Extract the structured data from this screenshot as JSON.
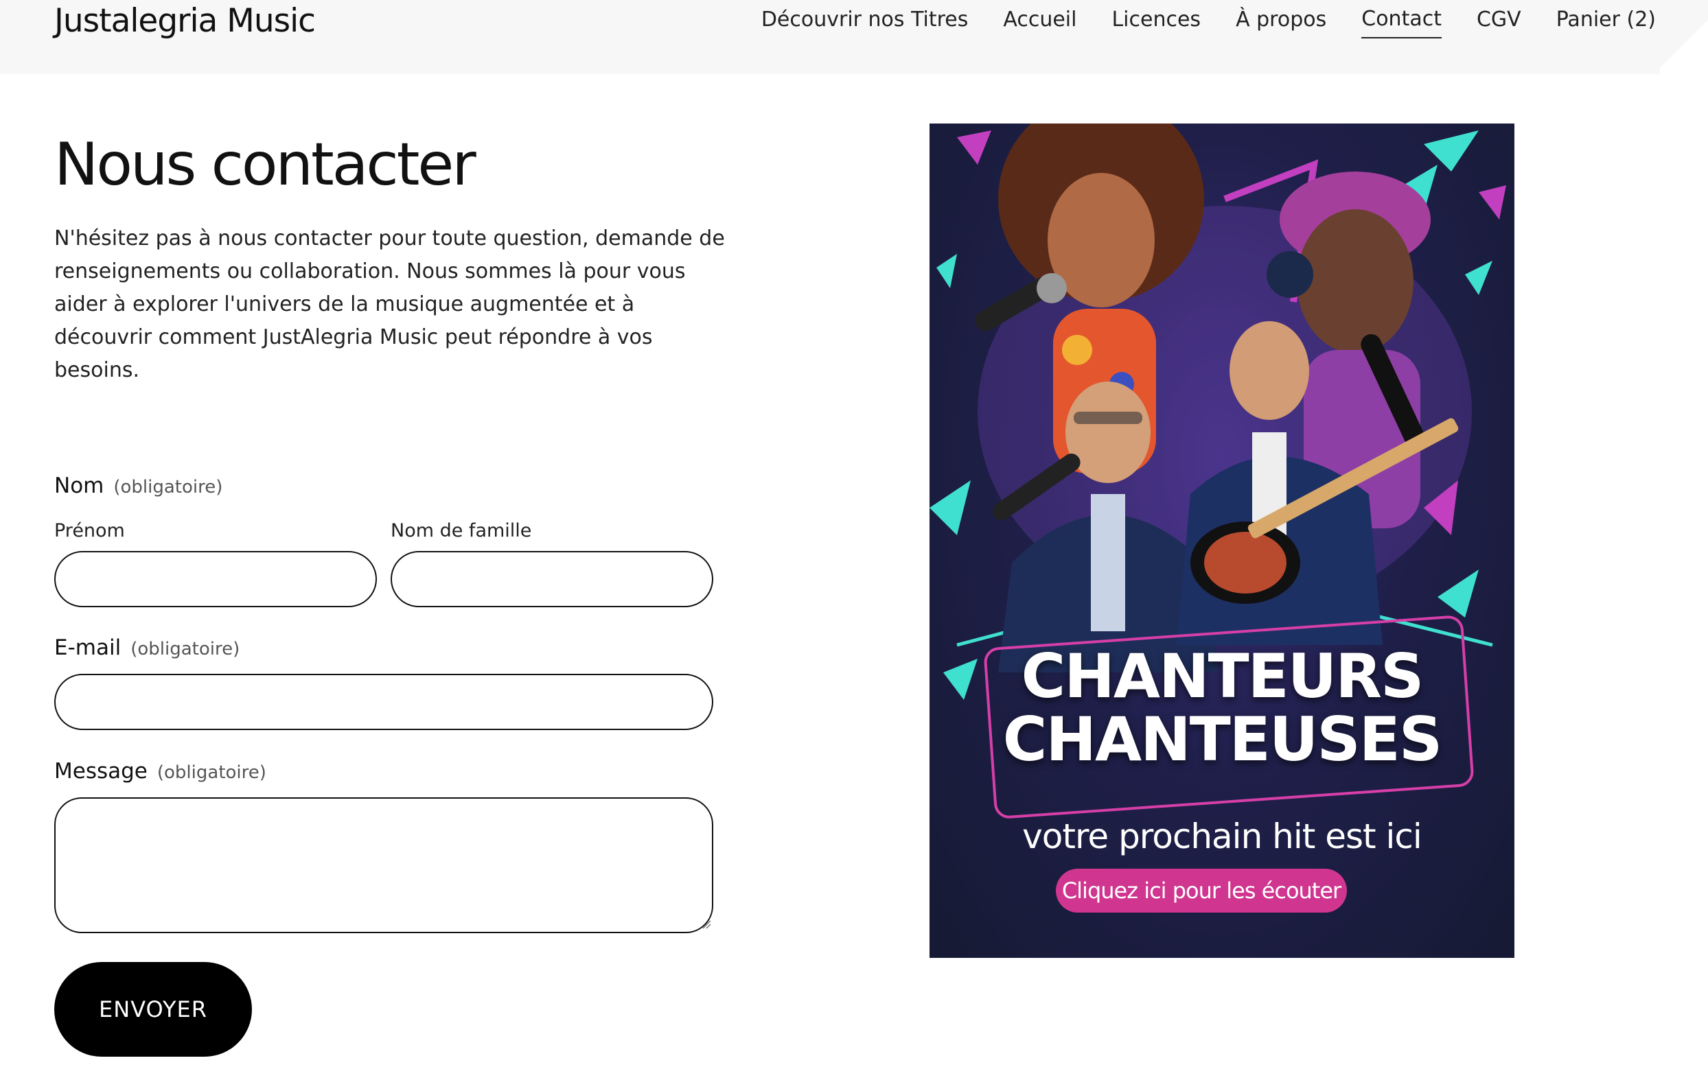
{
  "header": {
    "brand": "Justalegria Music",
    "nav": [
      {
        "label": "Découvrir nos Titres"
      },
      {
        "label": "Accueil"
      },
      {
        "label": "Licences"
      },
      {
        "label": "À propos"
      },
      {
        "label": "Contact"
      },
      {
        "label": "CGV"
      },
      {
        "label": "Panier (2)"
      }
    ]
  },
  "main": {
    "title": "Nous contacter",
    "intro": "N'hésitez pas à nous contacter pour toute question, demande de renseignements ou collaboration. Nous sommes là pour vous aider à explorer l'univers de la musique augmentée et à découvrir comment JustAlegria Music peut répondre à vos besoins."
  },
  "form": {
    "name_label": "Nom",
    "required": "(obligatoire)",
    "first_name_label": "Prénom",
    "last_name_label": "Nom de famille",
    "email_label": "E-mail",
    "message_label": "Message",
    "submit_label": "ENVOYER"
  },
  "poster": {
    "headline_1": "CHANTEURS",
    "headline_2": "CHANTEUSES",
    "tagline": "votre prochain hit est ici",
    "button": "Cliquez ici pour les écouter"
  },
  "colors": {
    "poster_pink": "#d0358f",
    "poster_teal": "#3fe0d0",
    "poster_bg": "#1f1f4a"
  }
}
